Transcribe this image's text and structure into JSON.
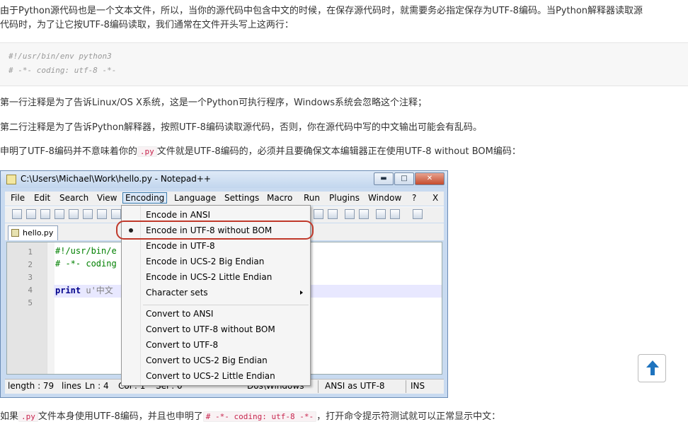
{
  "article": {
    "para1_line1": "由于Python源代码也是一个文本文件，所以，当你的源代码中包含中文的时候，在保存源代码时，就需要务必指定保存为UTF-8编码。当Python解释器读取源",
    "para1_line2": "代码时，为了让它按UTF-8编码读取，我们通常在文件开头写上这两行：",
    "code_line1": "#!/usr/bin/env python3",
    "code_line2": "# -*- coding: utf-8 -*-",
    "para2": "第一行注释是为了告诉Linux/OS X系统，这是一个Python可执行程序，Windows系统会忽略这个注释；",
    "para3": "第二行注释是为了告诉Python解释器，按照UTF-8编码读取源代码，否则，你在源代码中写的中文输出可能会有乱码。",
    "para4_a": "申明了UTF-8编码并不意味着你的",
    "para4_code": ".py",
    "para4_b": "文件就是UTF-8编码的，必须并且要确保文本编辑器正在使用UTF-8 without BOM编码：",
    "para5_a": "如果",
    "para5_code1": ".py",
    "para5_b": "文件本身使用UTF-8编码，并且也申明了",
    "para5_code2": "# -*- coding: utf-8 -*-",
    "para5_c": "，打开命令提示符测试就可以正常显示中文："
  },
  "window": {
    "title": "C:\\Users\\Michael\\Work\\hello.py - Notepad++",
    "buttons": {
      "minimize": "▬",
      "maximize": "□",
      "close": "✕"
    },
    "menu": [
      "File",
      "Edit",
      "Search",
      "View",
      "Encoding",
      "Language",
      "Settings",
      "Macro",
      "Run",
      "Plugins",
      "Window",
      "?",
      "X"
    ],
    "tab": "hello.py",
    "editor": {
      "line_numbers": [
        "1",
        "2",
        "3",
        "4",
        "5"
      ],
      "lines": [
        "#!/usr/bin/e",
        "# -*- coding",
        "",
        "print u'中文",
        ""
      ]
    },
    "status": {
      "length": "length : 79",
      "lines": "lines",
      "ln": "Ln : 4",
      "col": "Col : 1",
      "sel": "Sel : 0",
      "eol": "Dos\\Windows",
      "encoding": "ANSI as UTF-8",
      "mode": "INS"
    }
  },
  "encoding_menu": {
    "items": [
      "Encode in ANSI",
      "Encode in UTF-8 without BOM",
      "Encode in UTF-8",
      "Encode in UCS-2 Big Endian",
      "Encode in UCS-2 Little Endian",
      "Character sets",
      "Convert to ANSI",
      "Convert to UTF-8 without BOM",
      "Convert to UTF-8",
      "Convert to UCS-2 Big Endian",
      "Convert to UCS-2 Little Endian"
    ],
    "selected": "Encode in UTF-8 without BOM"
  },
  "colors": {
    "highlight_ring": "#c0392b",
    "scroll_top_arrow": "#1e73be",
    "inline_code": "#c7254e"
  }
}
